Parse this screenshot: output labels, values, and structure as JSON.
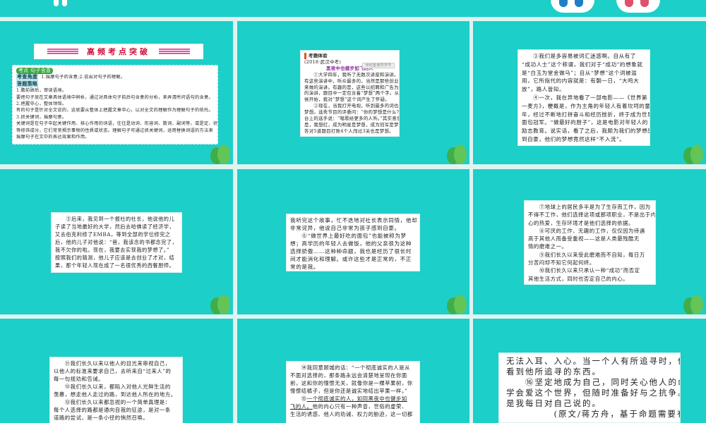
{
  "colors": {
    "slide_bg": "#1ccfc8",
    "accent_red": "#d0103a",
    "purple_title": "#8a2a9a",
    "tag_green": "#38a63e"
  },
  "slides": [
    {
      "header": "高频考点突破",
      "tag": "考点 句子含意",
      "angle_label": "考查角度",
      "angle_text": "1.揣摩句子的含意;2.说出对句子的理解。",
      "strategy_label": "答题策略",
      "lines": [
        "1.瞻前顾后，审读语境。",
        "要把句子放在文章具体语境中辨析，通过对具体句子前后句含意的分析，来弄清所问语句的含意。",
        "2.把握中心，整体领悟。",
        "有的句子是针对全文说的，这就要从整体上把握文章中心，以对全文的理解作为理解句子的依托。",
        "3.抓关键词，揣摩句意。",
        "关键词是在句子中起关键作用、核心作用的词语，往往是动词、形容词、数词、副词等，或是定、状、补",
        "等修饰成分，它们常常揭示事物的性质或状态。理解句子可通过抓关键词，运用替换词语的方法来",
        "揣摩句子在文中的表达效果和作用。"
      ]
    },
    {
      "exam_label": "考题体验",
      "source": "(2018·武汉中考)",
      "button": "世纪金榜导学号",
      "title": "黑夜中也健步如飞的人",
      "lines": [
        "　　①大学四年，我听了无数次讲座和演讲。在所",
        "有这些演讲中，听众最多的，当然是那些创业成功者",
        "来做的演讲。有趣的是，这些以招聘和广告为目的",
        "的演讲，题目中一定包含着“梦想”两个字。从那时",
        "候开始，我对“梦想”这个词产生了怀疑。",
        "　　②现在，当我打开电视，听到最多的词也是",
        "梦想。选秀节目的评委问：“你的梦想是什么？”",
        "台上的选手说：“唱歌给更多的人听。”其实意思",
        "是，我想红，成为明星是梦想，成为冠军是梦想，",
        "答对5道题目打败4个人闯过3关也是梦想。"
      ]
    },
    {
      "lines": [
        "　　③我们是多容易被词汇迷惑啊。自从有了",
        "“成功人士”这个称谓，我们对于“成功”的想象就",
        "是“白玉为堂金做马”；自从“梦想”这个词被滥",
        "用，它所指代的内容就是：有朝一日，“大鸣大",
        "放”，路人皆知。",
        "　　④一次，我在异地看了一部电影——《世界第",
        "一麦方》，梗概是，作为主角的年轻人有着坎坷的童",
        "年，经过不断地打拼奋斗和经历挫折，终于成为世界",
        "面包冠军。“做最好的厨子”，这是电影对年轻人的",
        "励志教育。说实话，看了之后，我颇为我们的梦想感",
        "到自豪，他们的梦想竟然这样“不入流”。"
      ]
    },
    {
      "lines": [
        "　　⑤后来，我见到一个报社的社长，他说他的儿",
        "子读了当地最好的大学，然后去哈佛读了经济学，",
        "又去伯克利修了EMBA，等到全部的学位修完之",
        "后，他的儿子对他说：“爸，我该念的书都念完了，",
        "我不欠你的啦。现在，我要去实现我的梦想了。”",
        "按照我们的猜测，他儿子应该是去创业了才对，结",
        "果，那个年轻人现在成了一名很优秀的西餐厨师。"
      ]
    },
    {
      "lines": [
        "我听完这个故事，忙不迭地对社长表示同情，他却",
        "非常诧异，他说自己非常为孩子感到自豪。",
        "　　⑥“做世界上最好吃的面包”也能被称为梦",
        "想；高学历的年轻人去做饭，他的父亲很为这种",
        "选择骄傲……这种种命题，我也是经历了很长时",
        "间才能消化和理解。或许这些才是正常的，不正",
        "常的是我。"
      ]
    },
    {
      "lines": [
        "　　⑦地球上的居民多半是为了生存而工作，因为",
        "不得不工作，他们选择这项或那项职业，不是出于内",
        "心的热爱，生存环境才是他们选择的依据。",
        "　　⑧可厌的工作、无趣的工作，仅仅因为待遇",
        "高于其他人而备受重视——这是人类最残酷无",
        "情的磨难之一。",
        "　　⑨我们长久以来受此磨难而不自知，每日万",
        "分苦闷却不知它何起何终。",
        "　　⑩我们长久以来只承认一种“成功”而否定",
        "其他生活方式，同时也否定自己的内心。"
      ]
    },
    {
      "lines": [
        "　　⑪我们长久以来以他人的目光来审视自己，",
        "以他人的标准来要求自己，去听来自“过来人”的",
        "每一句规劝和告诫。",
        "　　⑫我们长久以来，都陷入对他人光鲜生活的",
        "羡慕，想走他人走过的路，到达他人所在的地方。",
        "　　⑬我们长久以来都忽视的一个简单真理是：",
        "每个人选择的路都是通向自我的征途，是对一条",
        "道路的尝试，是一条小径的悄然召唤。"
      ]
    },
    {
      "lines": [
        "　　⑭我同意顾城的话：“一个彻底诚实的人是从",
        "不面对选择的，那条路永远会清楚地呈现在你面",
        "前，这和你的憧憬无关，就像你是一棵苹果树，你",
        "憧憬结橘子，但是你还是诚实地结出苹果一样。”"
      ],
      "underlined_a": "一个彻底诚实的人，如同黑夜中也健步如",
      "para15_prefix": "　　⑮",
      "underlined_b": "飞的人。",
      "after_b": "他的内心只有一种声音，世俗的虚荣、",
      "last": "生活的诱惑、他人的劝诫、权力的胁迫，这一切都"
    },
    {
      "lines": [
        "无法入耳、入心。当一个人有所追寻时，他只会",
        "看到他所追寻的东西。",
        "　　⑯坚定地成为自己，同时关心他人的命运。",
        "学会爱这个世界，但随时准备好与之抗争。这就",
        "是我每日对自己说的。",
        "　　　　　(原文/蒋方舟，基于命题需要有改动)"
      ]
    }
  ]
}
